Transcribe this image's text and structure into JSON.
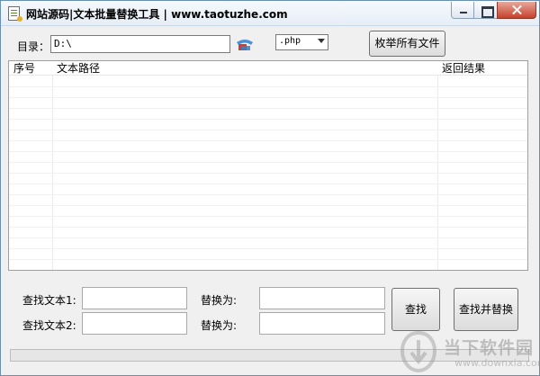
{
  "window": {
    "title": "网站源码|文本批量替换工具  | www.taotuzhe.com",
    "icon": "text-document-icon"
  },
  "toolbar": {
    "dir_label": "目录：",
    "dir_value": "D:\\",
    "browse_icon": "folder-browse-icon",
    "ext_value": ".php",
    "enum_button": "枚举所有文件"
  },
  "table": {
    "columns": [
      "序号",
      "文本路径",
      "返回结果"
    ],
    "rows": []
  },
  "search": {
    "find1_label": "查找文本1:",
    "find1_value": "",
    "replace1_label": "替换为:",
    "replace1_value": "",
    "find2_label": "查找文本2:",
    "find2_value": "",
    "replace2_label": "替换为:",
    "replace2_value": "",
    "find_button": "查找",
    "find_replace_button": "查找并替换"
  },
  "progress": {
    "value": 0
  },
  "watermark": {
    "name": "当下软件园",
    "url": "www.downxia.com"
  },
  "colors": {
    "titlebar": "#e6eef6",
    "close_button": "#c7402a",
    "progress_fill": "#06b025"
  }
}
